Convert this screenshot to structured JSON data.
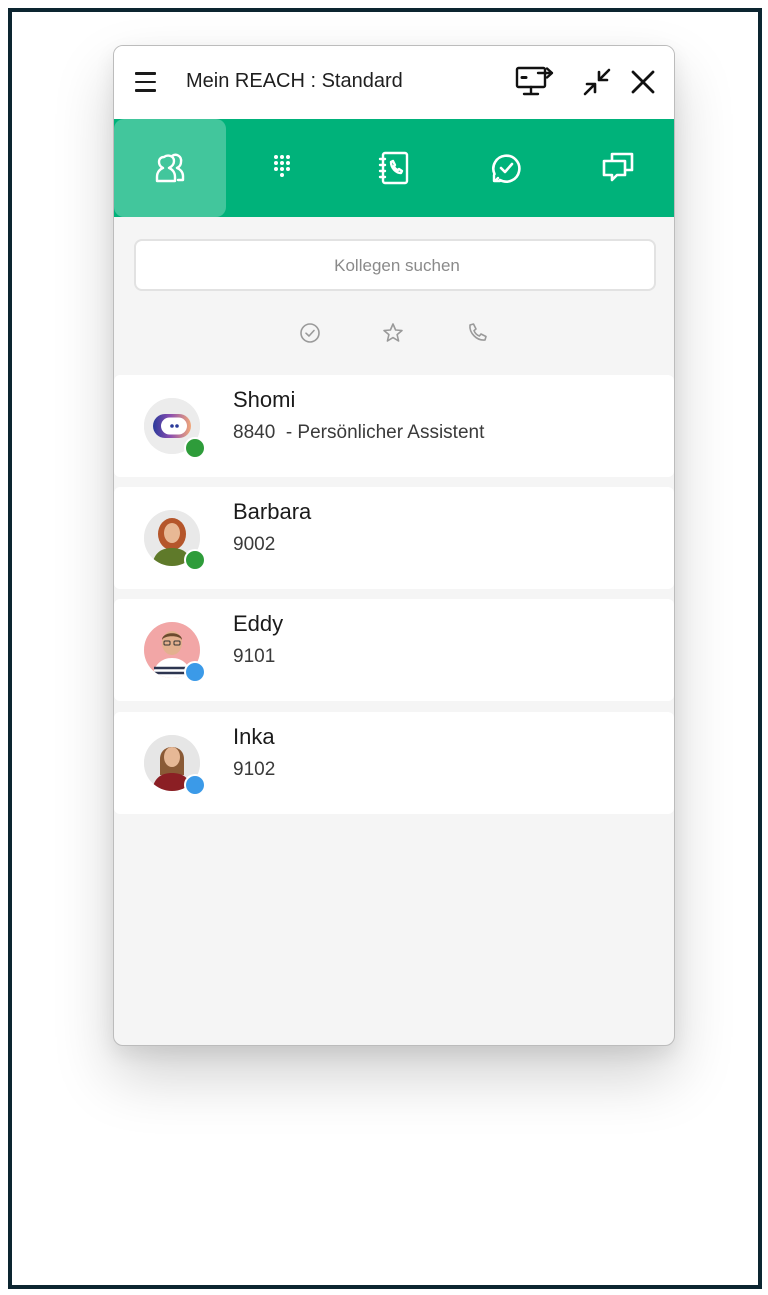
{
  "window": {
    "title": "Mein REACH : Standard"
  },
  "toolbar": {
    "menu_icon": "hamburger-menu-icon",
    "screen_icon": "screen-share-icon",
    "minimize_icon": "collapse-arrows-icon",
    "close_icon": "close-icon"
  },
  "nav": {
    "accent": "#00b27a",
    "tabs": [
      {
        "icon": "colleagues-icon",
        "active": true
      },
      {
        "icon": "dialpad-icon",
        "active": false
      },
      {
        "icon": "phonebook-icon",
        "active": false
      },
      {
        "icon": "call-history-icon",
        "active": false
      },
      {
        "icon": "chat-icon",
        "active": false
      }
    ]
  },
  "search": {
    "placeholder": "Kollegen suchen",
    "value": ""
  },
  "filters": [
    {
      "icon": "check-circle-icon"
    },
    {
      "icon": "star-icon"
    },
    {
      "icon": "phone-icon"
    }
  ],
  "contacts": [
    {
      "name": "Shomi",
      "extension": "8840  - Persönlicher Assistent",
      "status_color": "#2e9c3a",
      "avatar": "assistant-bot-avatar"
    },
    {
      "name": "Barbara",
      "extension": "9002",
      "status_color": "#2e9c3a",
      "avatar": "photo-avatar"
    },
    {
      "name": "Eddy",
      "extension": "9101",
      "status_color": "#3b9ae8",
      "avatar": "photo-avatar"
    },
    {
      "name": "Inka",
      "extension": "9102",
      "status_color": "#3b9ae8",
      "avatar": "photo-avatar"
    }
  ]
}
